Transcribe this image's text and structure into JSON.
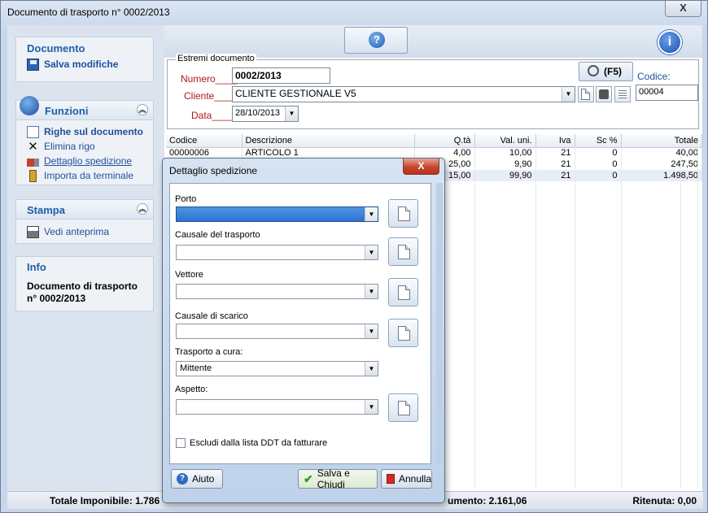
{
  "window": {
    "title": "Documento di trasporto n° 0002/2013",
    "close_label": "X"
  },
  "sidebar": {
    "documento": {
      "title": "Documento",
      "items": [
        {
          "label": "Salva modifiche",
          "icon": "floppy-icon"
        }
      ]
    },
    "funzioni": {
      "title": "Funzioni",
      "items": [
        {
          "label": "Righe sul documento",
          "icon": "document-icon"
        },
        {
          "label": "Elimina rigo",
          "icon": "x-icon"
        },
        {
          "label": "Dettaglio spedizione",
          "icon": "truck-icon"
        },
        {
          "label": "Importa da terminale",
          "icon": "terminal-icon"
        }
      ]
    },
    "stampa": {
      "title": "Stampa",
      "items": [
        {
          "label": "Vedi anteprima",
          "icon": "printer-icon"
        }
      ]
    },
    "info": {
      "title": "Info",
      "text": "Documento di trasporto n° 0002/2013"
    }
  },
  "toolbar": {
    "help_symbol": "?",
    "info_symbol": "i"
  },
  "estremi": {
    "legend": "Estremi documento",
    "numero_label": "Numero____",
    "numero_value": "0002/2013",
    "cliente_label": "Cliente_____",
    "cliente_value": "CLIENTE GESTIONALE V5",
    "data_label": "Data_____",
    "data_value": "28/10/2013",
    "search_label": "(F5)",
    "codice_label": "Codice:",
    "codice_value": "00004"
  },
  "grid": {
    "headers": [
      "Codice",
      "Descrizione",
      "Q.tà",
      "Val. uni.",
      "Iva",
      "Sc %",
      "Totale"
    ],
    "rows": [
      [
        "00000006",
        "ARTICOLO 1",
        "4,00",
        "10,00",
        "21",
        "0",
        "40,00"
      ],
      [
        "",
        "",
        "25,00",
        "9,90",
        "21",
        "0",
        "247,50"
      ],
      [
        "",
        "",
        "15,00",
        "99,90",
        "21",
        "0",
        "1.498,50"
      ]
    ]
  },
  "status": {
    "imponibile": "Totale Imponibile: 1.786",
    "documento": "umento: 2.161,06",
    "ritenuta": "Ritenuta: 0,00"
  },
  "dialog": {
    "title": "Dettaglio spedizione",
    "close_label": "X",
    "fields": [
      {
        "label": "Porto",
        "value": ""
      },
      {
        "label": "Causale del trasporto",
        "value": ""
      },
      {
        "label": "Vettore",
        "value": ""
      },
      {
        "label": "Causale di scarico",
        "value": ""
      },
      {
        "label": "Trasporto a cura:",
        "value": "Mittente"
      },
      {
        "label": "Aspetto:",
        "value": ""
      }
    ],
    "checkbox_label": "Escludi dalla lista DDT da fatturare",
    "help_button": "Aiuto",
    "save_button": "Salva e Chiudi",
    "cancel_button": "Annulla"
  }
}
